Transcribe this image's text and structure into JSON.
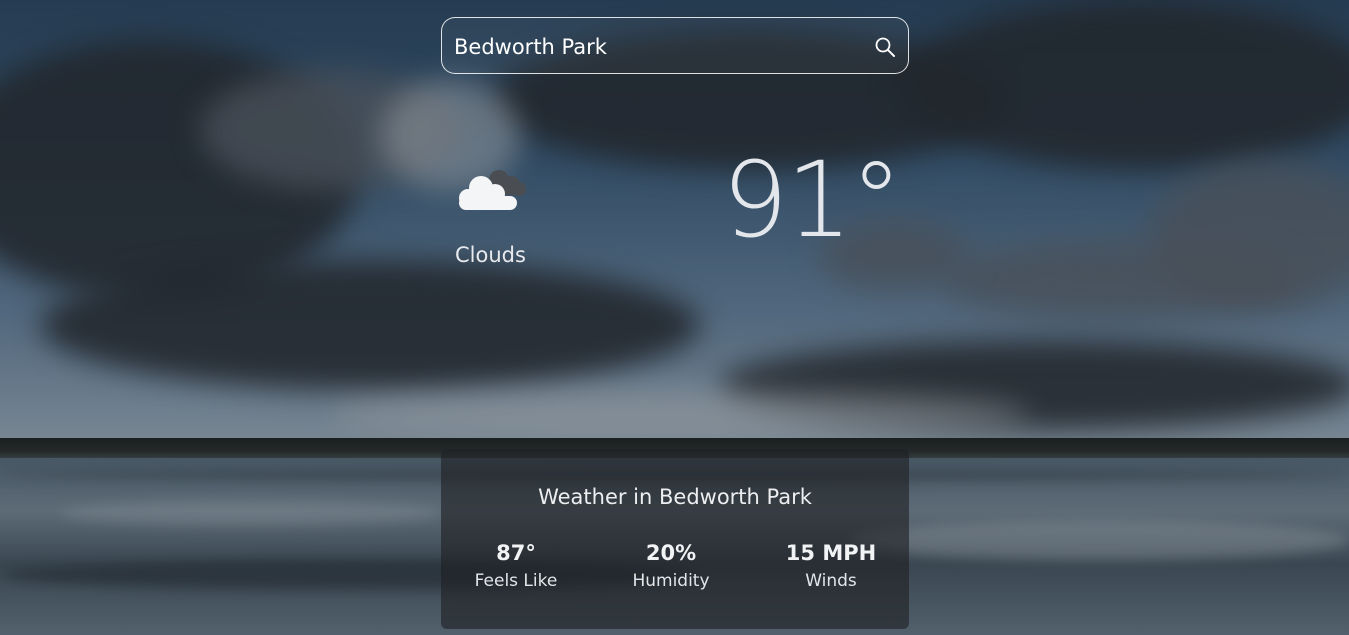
{
  "search": {
    "value": "Bedworth Park",
    "icon": "search-icon"
  },
  "current": {
    "condition_icon": "clouds-icon",
    "condition": "Clouds",
    "temperature": "91°"
  },
  "details": {
    "title": "Weather in Bedworth Park",
    "feels_like": {
      "value": "87°",
      "label": "Feels Like"
    },
    "humidity": {
      "value": "20%",
      "label": "Humidity"
    },
    "winds": {
      "value": "15 MPH",
      "label": "Winds"
    }
  },
  "colors": {
    "panel_bg": "#1e2024",
    "text": "#ffffff",
    "sky": "#3f6282"
  }
}
